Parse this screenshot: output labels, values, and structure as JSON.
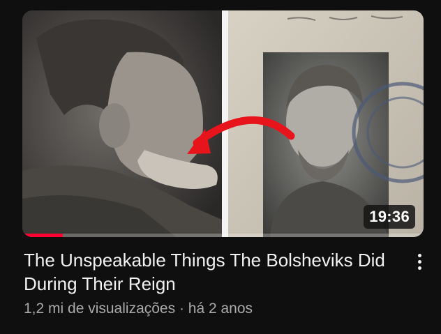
{
  "video": {
    "duration": "19:36",
    "watch_progress": 0.1,
    "title": "The Unspeakable Things The Bolsheviks Did During Their Reign",
    "views": "1,2 mi de visualizações",
    "separator": "·",
    "age": "há 2 anos",
    "overflow_icon": "more-vertical-icon"
  },
  "colors": {
    "background": "#0f0f0f",
    "progress": "#ff0033",
    "title": "#f1f1f1",
    "meta": "#aaaaaa"
  }
}
